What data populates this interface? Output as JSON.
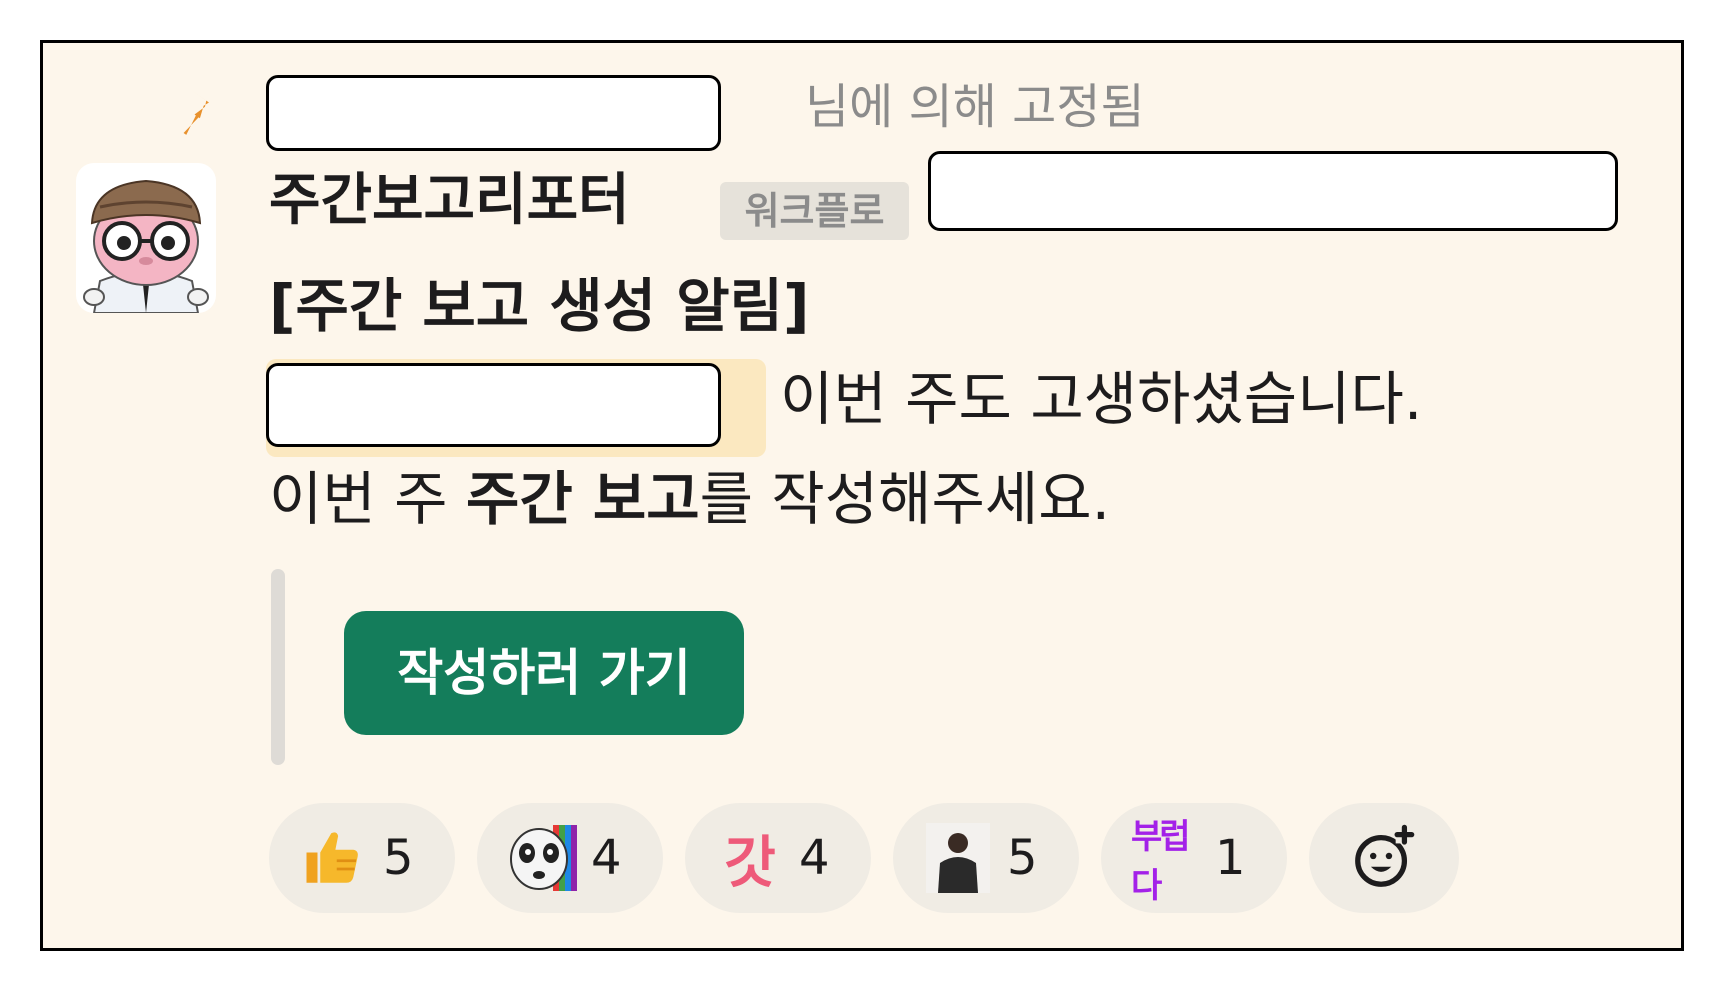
{
  "pin": {
    "suffix_text": "님에 의해 고정됨"
  },
  "message": {
    "sender": "주간보고리포터",
    "sender_badge": "워크플로",
    "title": "[주간 보고 생성 알림]",
    "line1_text": "이번 주도 고생하셨습니다.",
    "line2_prefix": "이번 주 ",
    "line2_bold": "주간 보고",
    "line2_suffix": "를 작성해주세요.",
    "action_button_label": "작성하러 가기"
  },
  "reactions": [
    {
      "emoji": "thumbs-up-icon",
      "count": "5"
    },
    {
      "emoji": "panda-rainbow-icon",
      "count": "4"
    },
    {
      "emoji": "gat-text-icon",
      "count": "4",
      "emoji_text": "갓"
    },
    {
      "emoji": "person-photo-icon",
      "count": "5"
    },
    {
      "emoji": "bureopda-text-icon",
      "count": "1",
      "emoji_text": "부럽다"
    }
  ],
  "colors": {
    "background": "#fdf6eb",
    "button": "#147d5b",
    "pin": "#e8912d",
    "reaction_bg": "#f0ece4"
  }
}
